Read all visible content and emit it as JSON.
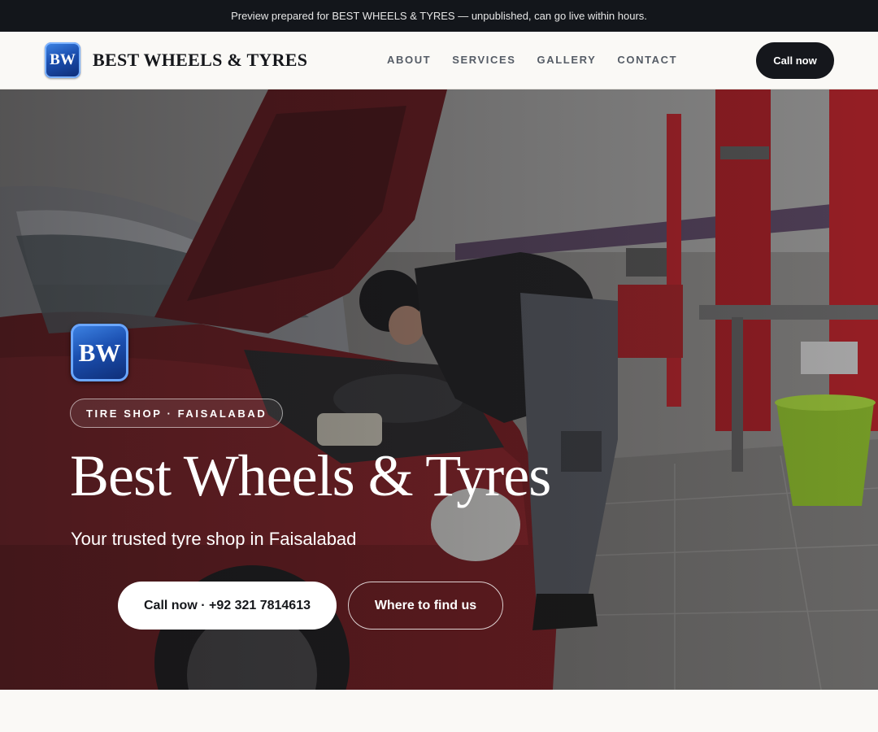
{
  "banner": {
    "text": "Preview prepared for BEST WHEELS & TYRES — unpublished, can go live within hours."
  },
  "header": {
    "logo_text": "BW",
    "brand": "BEST WHEELS & TYRES",
    "nav": [
      "ABOUT",
      "SERVICES",
      "GALLERY",
      "CONTACT"
    ],
    "cta": "Call now"
  },
  "hero": {
    "logo_text": "BW",
    "tag": "TIRE SHOP · FAISALABAD",
    "title": "Best Wheels & Tyres",
    "subtitle": "Your trusted tyre shop in Faisalabad",
    "primary_button": "Call now · +92 321 7814613",
    "secondary_button": "Where to find us",
    "image_subject": "mechanic working under the open hood of a red car in a tyre workshop"
  },
  "colors": {
    "dark": "#13161b",
    "brand_blue": "#1b4fb0",
    "accent_red": "#b8232a"
  }
}
